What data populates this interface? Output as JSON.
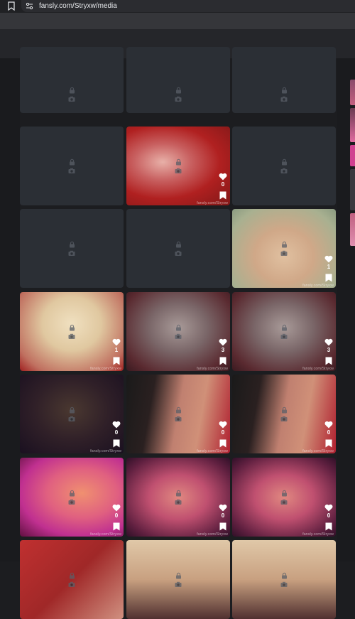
{
  "browser": {
    "url": "fansly.com/Stryxw/media",
    "bookmark_icon": "bookmark-icon",
    "site_info_icon": "site-settings-icon"
  },
  "colors": {
    "background": "#1c1d20",
    "locked_tile": "#2b2f35",
    "lock_icon": "#4d525a"
  },
  "watermark": "fansly.com/Stryxw",
  "tiles": [
    {
      "type": "locked",
      "likes": null
    },
    {
      "type": "locked",
      "likes": null
    },
    {
      "type": "locked",
      "likes": null
    },
    {
      "type": "locked",
      "likes": null
    },
    {
      "type": "preview",
      "likes": "0",
      "palette": "red-pink"
    },
    {
      "type": "locked",
      "likes": null
    },
    {
      "type": "locked",
      "likes": null
    },
    {
      "type": "locked",
      "likes": null
    },
    {
      "type": "preview",
      "likes": "1",
      "palette": "skin-green"
    },
    {
      "type": "preview",
      "likes": "1",
      "palette": "skin-red"
    },
    {
      "type": "preview",
      "likes": "3",
      "palette": "grey-maroon"
    },
    {
      "type": "preview",
      "likes": "3",
      "palette": "grey-maroon"
    },
    {
      "type": "preview",
      "likes": "0",
      "palette": "dark-purple"
    },
    {
      "type": "preview",
      "likes": "0",
      "palette": "dark-red-skin"
    },
    {
      "type": "preview",
      "likes": "0",
      "palette": "dark-red-skin"
    },
    {
      "type": "preview",
      "likes": "0",
      "palette": "pink-orange"
    },
    {
      "type": "preview",
      "likes": "0",
      "palette": "purple-pink"
    },
    {
      "type": "preview",
      "likes": "0",
      "palette": "purple-pink"
    },
    {
      "type": "preview",
      "likes": null,
      "palette": "red-skin"
    },
    {
      "type": "preview",
      "likes": null,
      "palette": "skin-dark"
    },
    {
      "type": "preview",
      "likes": null,
      "palette": "skin-dark"
    }
  ]
}
